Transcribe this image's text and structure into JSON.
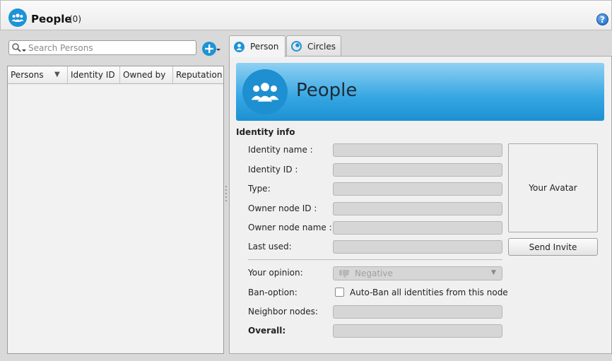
{
  "header": {
    "title": "People",
    "count": "(0)",
    "help_glyph": "?"
  },
  "search": {
    "placeholder": "Search Persons",
    "value": ""
  },
  "persons_table": {
    "columns": [
      "Persons",
      "Identity ID",
      "Owned by",
      "Reputation"
    ],
    "rows": []
  },
  "tabs": [
    {
      "label": "Person",
      "icon": "person-icon",
      "active": true
    },
    {
      "label": "Circles",
      "icon": "circles-icon",
      "active": false
    }
  ],
  "banner": {
    "title": "People"
  },
  "identity_info": {
    "section_title": "Identity info",
    "fields": [
      {
        "label": "Identity name :",
        "value": ""
      },
      {
        "label": "Identity ID :",
        "value": ""
      },
      {
        "label": "Type:",
        "value": ""
      },
      {
        "label": "Owner node ID :",
        "value": ""
      },
      {
        "label": "Owner node name :",
        "value": ""
      },
      {
        "label": "Last used:",
        "value": ""
      }
    ],
    "avatar_label": "Your Avatar",
    "send_invite_label": "Send Invite",
    "opinion": {
      "label": "Your opinion:",
      "selected": "Negative"
    },
    "ban_option": {
      "label": "Ban-option:",
      "checkbox_label": "Auto-Ban all identities from this node",
      "checked": false
    },
    "neighbor_nodes": {
      "label": "Neighbor nodes:",
      "value": ""
    },
    "overall": {
      "label": "Overall:",
      "value": ""
    }
  },
  "colors": {
    "accent": "#1e93d6",
    "banner_top": "#8fd0f3",
    "banner_bottom": "#1c91d3",
    "field_disabled": "#d6d6d6"
  }
}
